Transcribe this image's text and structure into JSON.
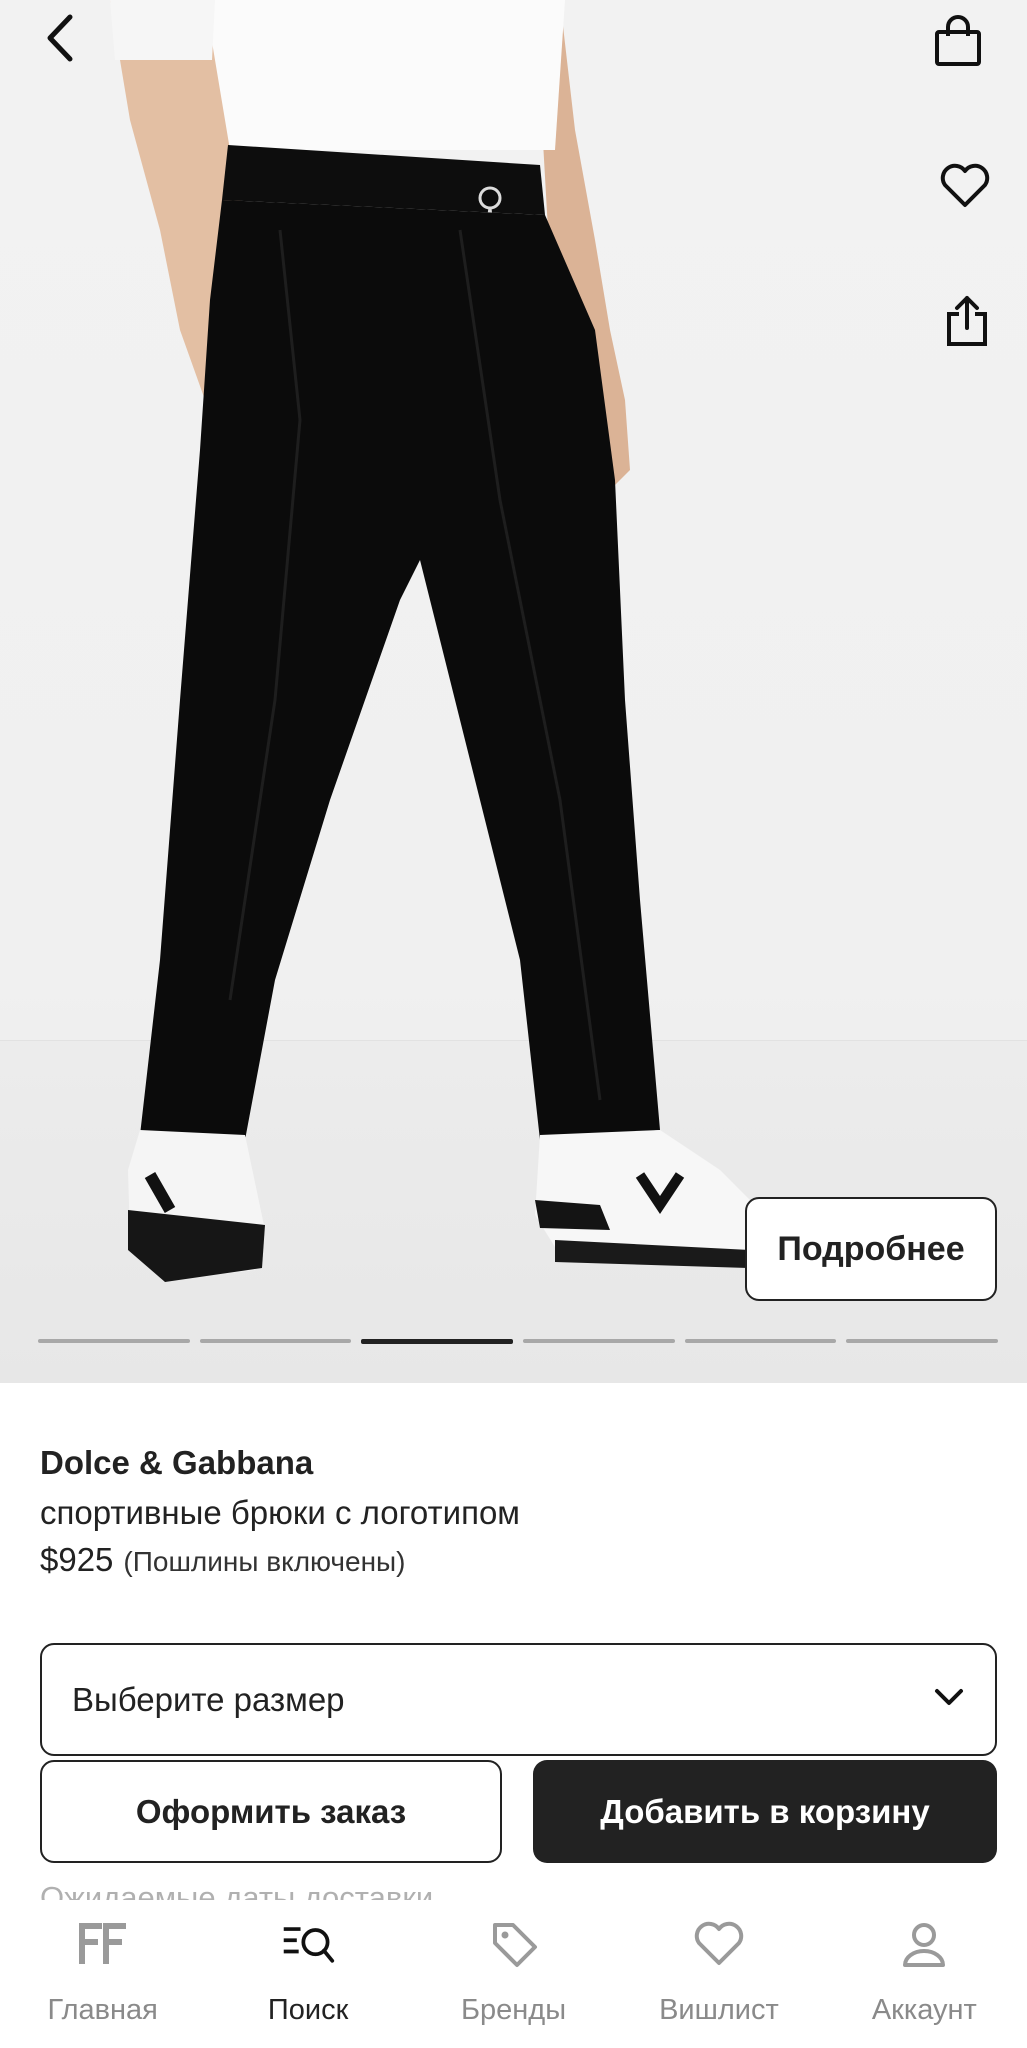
{
  "header": {
    "back_icon": "chevron-left-icon",
    "bag_icon": "shopping-bag-icon",
    "wishlist_icon": "heart-icon",
    "share_icon": "share-icon"
  },
  "gallery": {
    "details_button": "Подробнее",
    "image_count": 6,
    "active_index": 2
  },
  "product": {
    "brand": "Dolce & Gabbana",
    "name": "спортивные брюки с логотипом",
    "price": "$925",
    "duties_note": "(Пошлины включены)"
  },
  "size_select": {
    "label": "Выберите размер",
    "icon": "chevron-down-icon"
  },
  "actions": {
    "checkout_label": "Оформить заказ",
    "add_to_cart_label": "Добавить в корзину"
  },
  "delivery_label": "Ожидаемые даты доставки",
  "tabbar": {
    "items": [
      {
        "label": "Главная",
        "icon": "farfetch-logo-icon"
      },
      {
        "label": "Поиск",
        "icon": "search-icon"
      },
      {
        "label": "Бренды",
        "icon": "tag-icon"
      },
      {
        "label": "Вишлист",
        "icon": "heart-icon"
      },
      {
        "label": "Аккаунт",
        "icon": "user-icon"
      }
    ],
    "active_index": 1
  },
  "colors": {
    "text": "#222222",
    "muted": "#8a8a8a",
    "primary_button": "#222222",
    "background": "#ffffff"
  }
}
